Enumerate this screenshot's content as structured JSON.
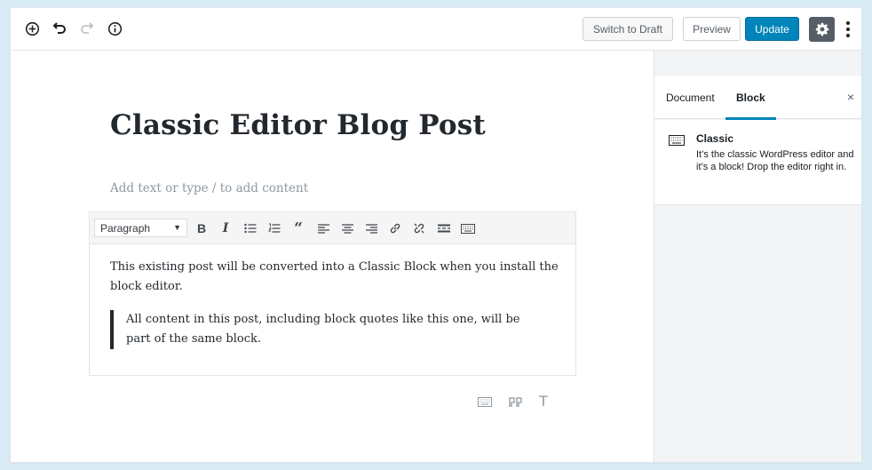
{
  "toolbar": {
    "add_icon": "plus-circle-icon",
    "undo_icon": "undo-icon",
    "redo_icon": "redo-icon",
    "info_icon": "info-icon",
    "switch_to_draft": "Switch to Draft",
    "preview": "Preview",
    "update": "Update",
    "settings_icon": "gear-icon",
    "more_icon": "more-vertical-icon"
  },
  "editor": {
    "title": "Classic Editor Blog Post",
    "placeholder": "Add text or type / to add content",
    "classic_block": {
      "format_select": "Paragraph",
      "format_caret": "▼",
      "buttons": [
        "bold",
        "italic",
        "bullet-list",
        "numbered-list",
        "blockquote",
        "align-left",
        "align-center",
        "align-right",
        "link",
        "unlink",
        "read-more",
        "toolbar-toggle"
      ],
      "bold_label": "B",
      "italic_label": "I",
      "paragraph": "This existing post will be converted into a Classic Block when you install the block editor.",
      "quote": "All content in this post, including block quotes like this one, will be part of the same block."
    },
    "block_switchers": [
      "keyboard-icon",
      "quote-icon",
      "heading-icon"
    ],
    "heading_switcher_label": "T"
  },
  "sidebar": {
    "tabs": [
      {
        "label": "Document",
        "active": false
      },
      {
        "label": "Block",
        "active": true
      }
    ],
    "close_label": "×",
    "block_card": {
      "icon": "keyboard-icon",
      "title": "Classic",
      "description": "It’s the classic WordPress editor and it’s a block! Drop the editor right in."
    }
  },
  "colors": {
    "accent": "#0085ba",
    "background": "#d9ecf6",
    "sidebar_bg": "#f3f4f5"
  }
}
